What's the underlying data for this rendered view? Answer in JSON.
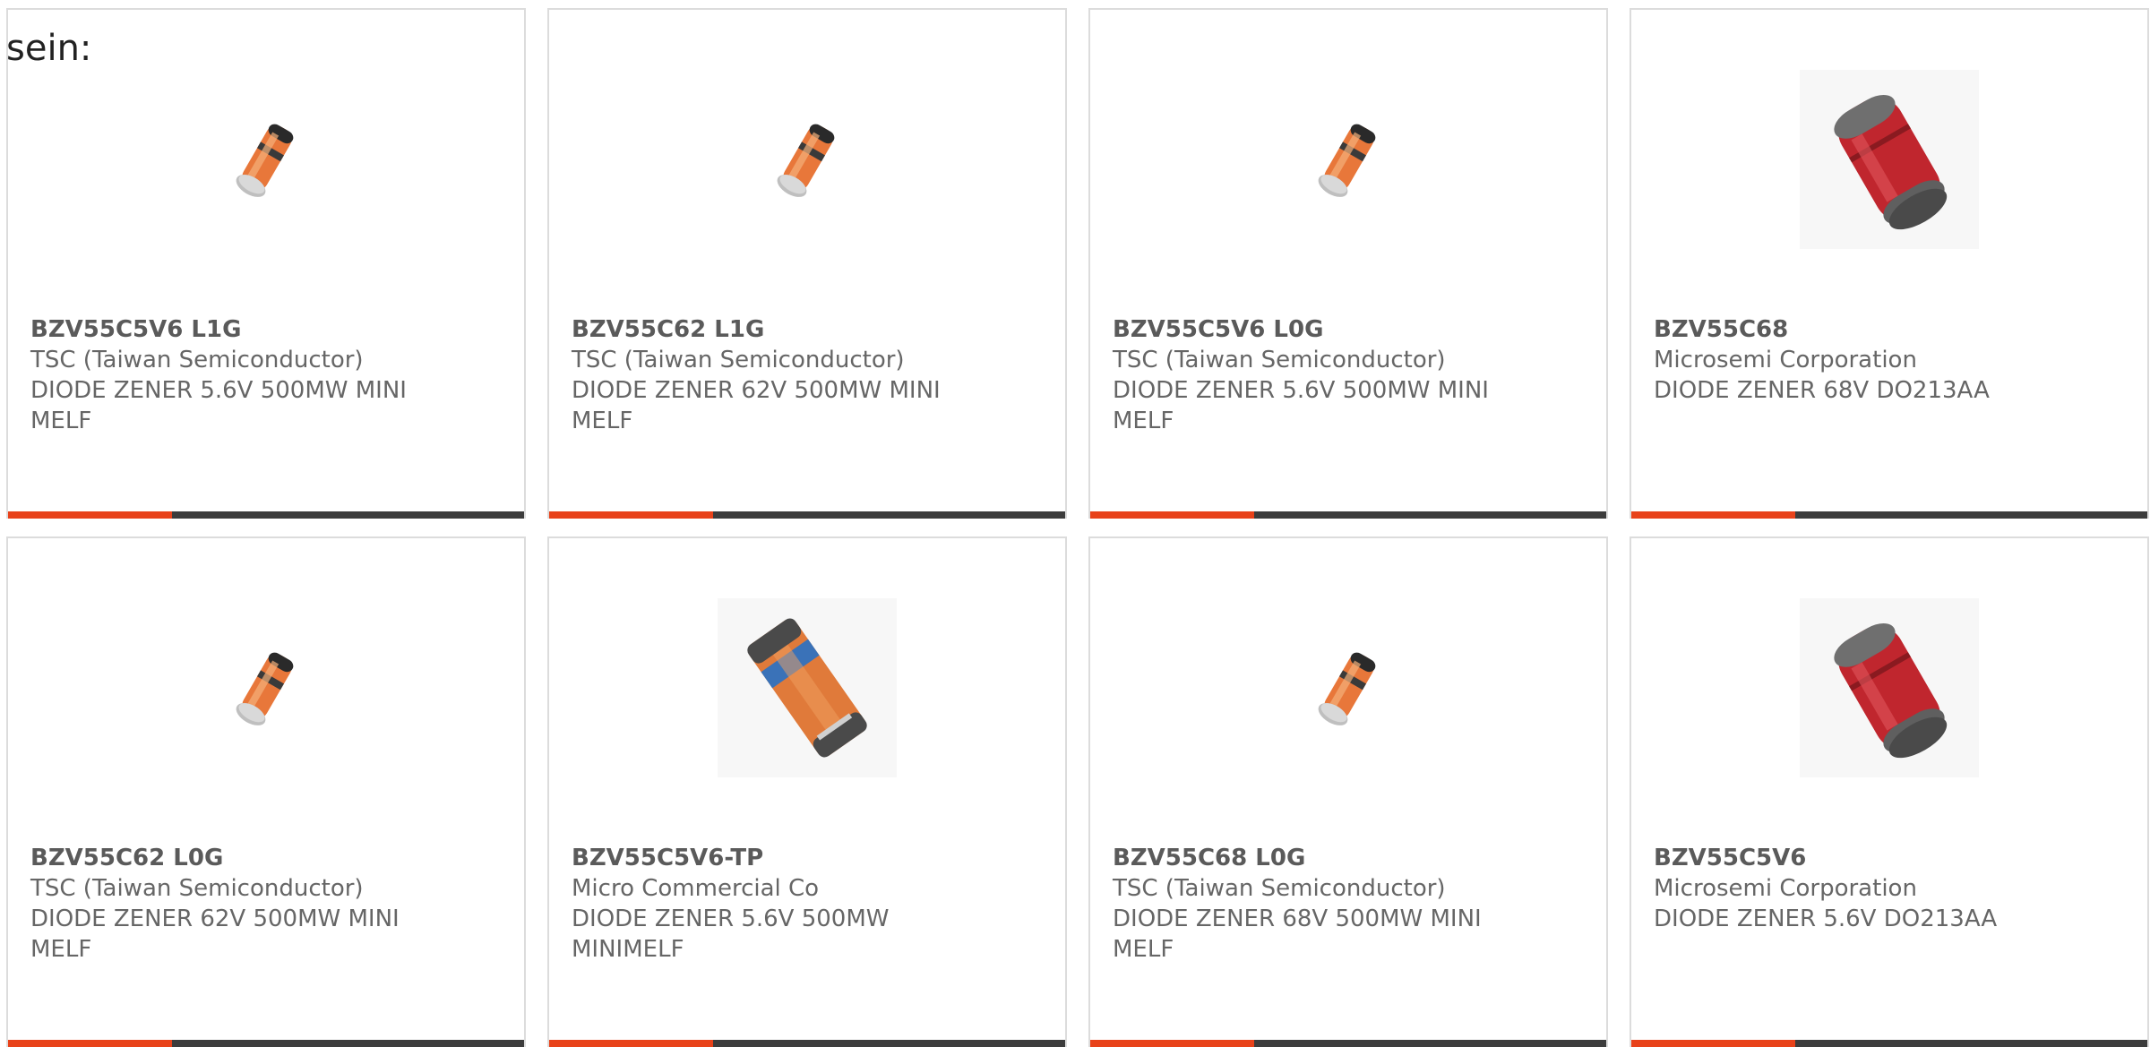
{
  "intro_text": "sein:",
  "colors": {
    "accent": "#e8421a",
    "bar": "#3c3c3c",
    "border": "#dcdcdc",
    "text": "#666666"
  },
  "products": [
    {
      "part_number": "BZV55C5V6 L1G",
      "manufacturer": "TSC (Taiwan Semiconductor)",
      "description": "DIODE ZENER 5.6V 500MW MINI MELF",
      "image": "orange-minimelf-diode-icon"
    },
    {
      "part_number": "BZV55C62 L1G",
      "manufacturer": "TSC (Taiwan Semiconductor)",
      "description": "DIODE ZENER 62V 500MW MINI MELF",
      "image": "orange-minimelf-diode-icon"
    },
    {
      "part_number": "BZV55C5V6 L0G",
      "manufacturer": "TSC (Taiwan Semiconductor)",
      "description": "DIODE ZENER 5.6V 500MW MINI MELF",
      "image": "orange-minimelf-diode-icon"
    },
    {
      "part_number": "BZV55C68",
      "manufacturer": "Microsemi Corporation",
      "description": "DIODE ZENER 68V DO213AA",
      "image": "red-do213aa-diode-icon"
    },
    {
      "part_number": "BZV55C62 L0G",
      "manufacturer": "TSC (Taiwan Semiconductor)",
      "description": "DIODE ZENER 62V 500MW MINI MELF",
      "image": "orange-minimelf-diode-icon"
    },
    {
      "part_number": "BZV55C5V6-TP",
      "manufacturer": "Micro Commercial Co",
      "description": "DIODE ZENER 5.6V 500MW MINIMELF",
      "image": "orange-blue-minimelf-diode-icon"
    },
    {
      "part_number": "BZV55C68 L0G",
      "manufacturer": "TSC (Taiwan Semiconductor)",
      "description": "DIODE ZENER 68V 500MW MINI MELF",
      "image": "orange-minimelf-diode-icon"
    },
    {
      "part_number": "BZV55C5V6",
      "manufacturer": "Microsemi Corporation",
      "description": "DIODE ZENER 5.6V DO213AA",
      "image": "red-do213aa-diode-icon"
    }
  ]
}
